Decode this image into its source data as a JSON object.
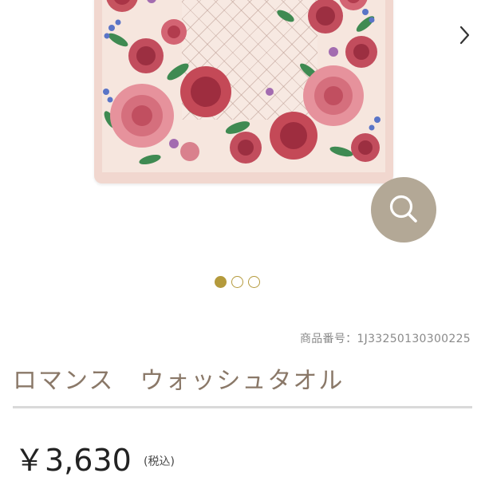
{
  "product": {
    "sku_label": "商品番号：1J33250130300225",
    "title": "ロマンス　ウォッシュタオル",
    "price": "￥3,630",
    "tax_note": "(税込)"
  },
  "gallery": {
    "total_images": 3,
    "active_index": 0,
    "accent_color": "#b49a3c",
    "zoom_button_color": "#b3a896"
  },
  "icons": [
    "chevron-right-icon",
    "search-icon"
  ]
}
